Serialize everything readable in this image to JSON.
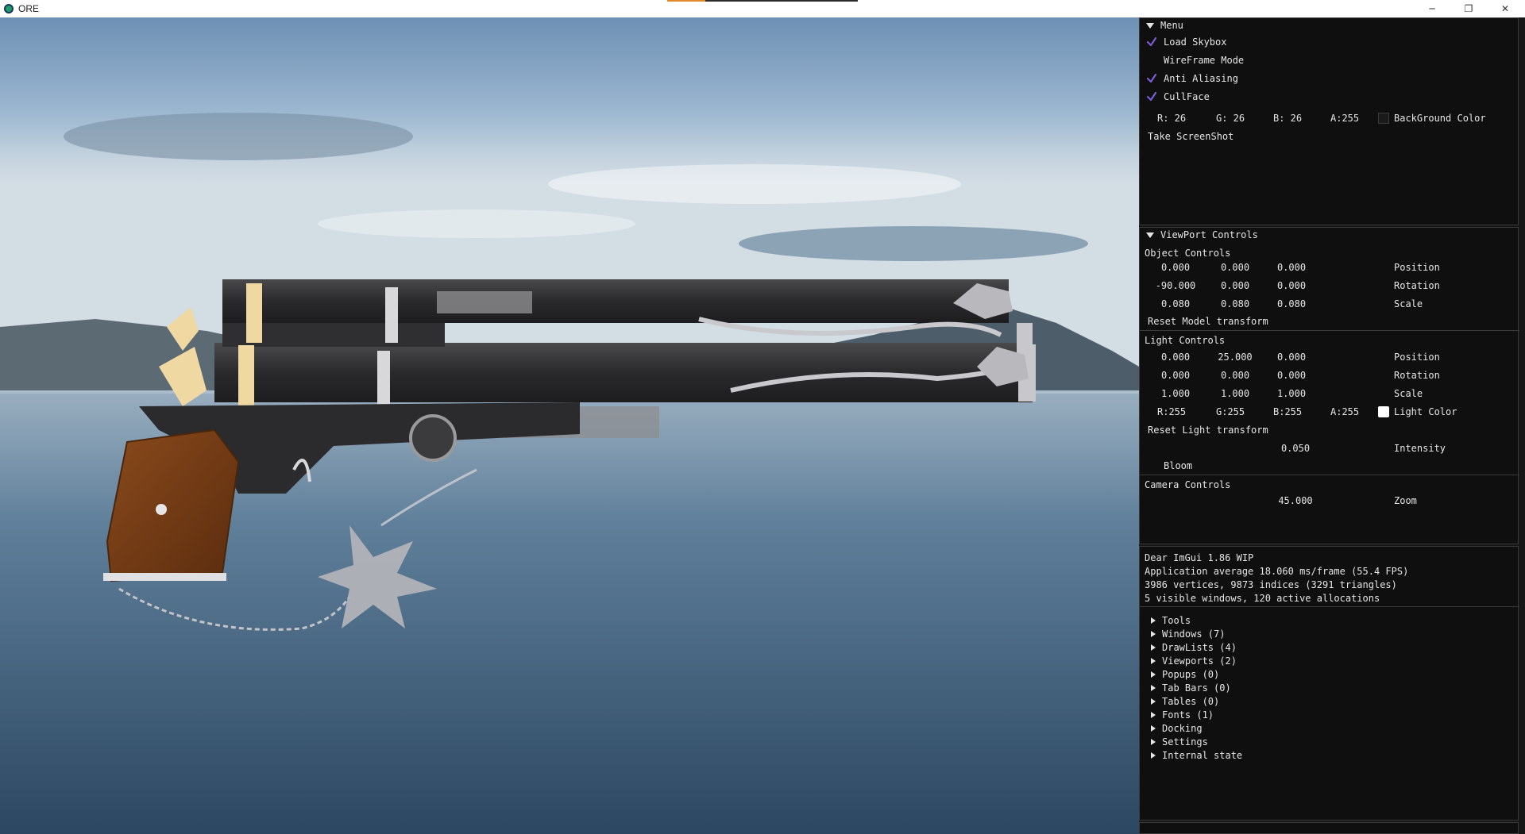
{
  "titlebar": {
    "title": "ORE",
    "minimize_glyph": "─",
    "restore_glyph": "❐",
    "close_glyph": "✕",
    "progress_fraction": 0.2
  },
  "menu": {
    "title": "Menu",
    "items": [
      {
        "label": "Load Skybox",
        "checked": true
      },
      {
        "label": "WireFrame Mode",
        "checked": false
      },
      {
        "label": "Anti Aliasing",
        "checked": true
      },
      {
        "label": "CullFace",
        "checked": true
      }
    ],
    "background": {
      "r": "R: 26",
      "g": "G: 26",
      "b": "B: 26",
      "a": "A:255",
      "label": "BackGround Color",
      "color": "#1a1a1a"
    },
    "screenshot_button": "Take ScreenShot"
  },
  "viewport_controls": {
    "title": "ViewPort Controls",
    "object": {
      "heading": "Object Controls",
      "position": {
        "x": "0.000",
        "y": "0.000",
        "z": "0.000",
        "label": "Position"
      },
      "rotation": {
        "x": "-90.000",
        "y": "0.000",
        "z": "0.000",
        "label": "Rotation"
      },
      "scale": {
        "x": "0.080",
        "y": "0.080",
        "z": "0.080",
        "label": "Scale"
      },
      "reset_button": "Reset Model transform"
    },
    "light": {
      "heading": "Light Controls",
      "position": {
        "x": "0.000",
        "y": "25.000",
        "z": "0.000",
        "label": "Position"
      },
      "rotation": {
        "x": "0.000",
        "y": "0.000",
        "z": "0.000",
        "label": "Rotation"
      },
      "scale": {
        "x": "1.000",
        "y": "1.000",
        "z": "1.000",
        "label": "Scale"
      },
      "color": {
        "r": "R:255",
        "g": "G:255",
        "b": "B:255",
        "a": "A:255",
        "label": "Light Color",
        "color": "#ffffff"
      },
      "reset_button": "Reset Light transform",
      "intensity": {
        "value": "0.050",
        "label": "Intensity"
      },
      "bloom": {
        "label": "Bloom",
        "checked": false
      }
    },
    "camera": {
      "heading": "Camera Controls",
      "zoom": {
        "value": "45.000",
        "label": "Zoom"
      }
    }
  },
  "metrics": {
    "lines": [
      "Dear ImGui 1.86 WIP",
      "Application average 18.060 ms/frame (55.4 FPS)",
      "3986 vertices, 9873 indices (3291 triangles)",
      "5 visible windows, 120 active allocations"
    ],
    "tree": [
      "Tools",
      "Windows (7)",
      "DrawLists (4)",
      "Viewports (2)",
      "Popups (0)",
      "Tab Bars (0)",
      "Tables (0)",
      "Fonts (1)",
      "Docking",
      "Settings",
      "Internal state"
    ]
  },
  "colors": {
    "check": "#7b5cd6",
    "panel_bg": "#0f0f0f",
    "border": "#3a3a3a",
    "progress": "#e3872b"
  }
}
